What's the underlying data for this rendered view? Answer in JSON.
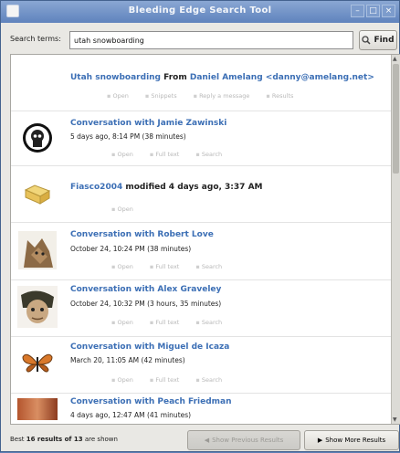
{
  "window": {
    "title": "Bleeding Edge Search Tool",
    "controls": [
      "–",
      "□",
      "×"
    ]
  },
  "search": {
    "label": "Search terms:",
    "value": "utah snowboarding",
    "button": "Find"
  },
  "results": [
    {
      "title_link": "Utah snowboarding",
      "title_plain": " From ",
      "title_link2": "Daniel Amelang <danny@amelang.net>",
      "subtitle": "",
      "thumb": "blank",
      "actions": [
        "Open",
        "Snippets",
        "Reply a message",
        "Results"
      ]
    },
    {
      "title_link": "Conversation with Jamie Zawinski",
      "title_plain": "",
      "title_link2": "",
      "subtitle": "5 days ago, 8:14 PM (38 minutes)",
      "thumb": "skull",
      "actions": [
        "Open",
        "Full text",
        "Search"
      ]
    },
    {
      "title_link": "Fiasco2004",
      "title_plain": " modified 4 days ago, 3:37 AM",
      "title_link2": "",
      "subtitle": "",
      "thumb": "folder",
      "actions": [
        "Open"
      ]
    },
    {
      "title_link": "Conversation with Robert Love",
      "title_plain": "",
      "title_link2": "",
      "subtitle": "October 24, 10:24 PM (38 minutes)",
      "thumb": "cat",
      "actions": [
        "Open",
        "Full text",
        "Search"
      ]
    },
    {
      "title_link": "Conversation with Alex Graveley",
      "title_plain": "",
      "title_link2": "",
      "subtitle": "October 24, 10:32 PM (3 hours, 35 minutes)",
      "thumb": "monkey",
      "actions": [
        "Open",
        "Full text",
        "Search"
      ]
    },
    {
      "title_link": "Conversation with Miguel de Icaza",
      "title_plain": "",
      "title_link2": "",
      "subtitle": "March 20, 11:05 AM (42 minutes)",
      "thumb": "butterfly",
      "actions": [
        "Open",
        "Full text",
        "Search"
      ]
    },
    {
      "title_link": "Conversation with Peach Friedman",
      "title_plain": "",
      "title_link2": "",
      "subtitle": "4 days ago, 12:47 AM (41 minutes)",
      "thumb": "photo",
      "actions": []
    }
  ],
  "footer": {
    "count_prefix": "Best ",
    "count_bold": "16 results of 13",
    "count_suffix": " are shown",
    "prev_button": "Show Previous Results",
    "next_button": "Show More Results"
  },
  "colors": {
    "link": "#3c6fb5",
    "titlebar": "#6f91c7"
  }
}
